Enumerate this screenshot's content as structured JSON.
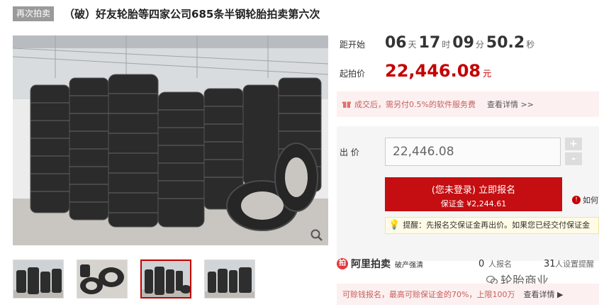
{
  "header": {
    "tag": "再次拍卖",
    "title": "（破）好友轮胎等四家公司685条半钢轮胎拍卖第六次"
  },
  "countdown": {
    "label": "距开始",
    "days": "06",
    "days_unit": "天",
    "hours": "17",
    "hours_unit": "时",
    "minutes": "09",
    "minutes_unit": "分",
    "seconds": "50.2",
    "seconds_unit": "秒"
  },
  "start_price": {
    "label": "起拍价",
    "value": "22,446.08",
    "unit": "元"
  },
  "fee_notice": {
    "text": "成交后，需另付0.5%的软件服务费",
    "link": "查看详情 >>"
  },
  "bid": {
    "label": "出  价",
    "value": "22,446.08",
    "plus": "+",
    "minus": "-"
  },
  "signup_button": {
    "main": "(您未登录) 立即报名",
    "sub": "保证金 ¥2,244.61"
  },
  "help": {
    "text": "如何"
  },
  "tip": {
    "text": "提醒：先报名交保证金再出价。如果您已经交付保证金"
  },
  "brand": {
    "name": "阿里拍卖",
    "logo_char": "拍",
    "sub": "破产强清",
    "enrolled_count": "0",
    "enrolled_label": "人报名",
    "reminder_count": "31",
    "reminder_label": "人设置提醒"
  },
  "watermark": {
    "text": "轮胎商业"
  },
  "loan": {
    "text": "可赊钱报名，最高可赊保证金的70%，上限100万",
    "link": "查看详情 ▶"
  },
  "colors": {
    "accent": "#c40000",
    "button": "#c40e12",
    "notice_bg": "#fdf0f0"
  }
}
